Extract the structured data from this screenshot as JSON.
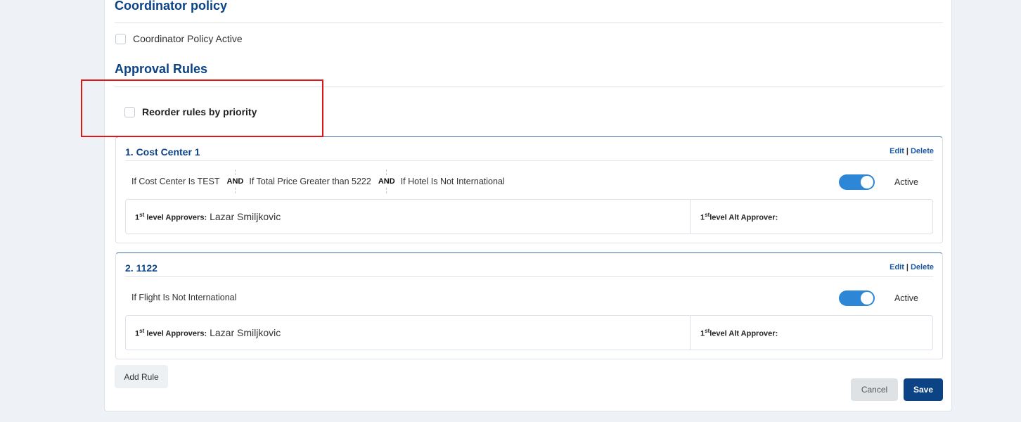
{
  "coordinator": {
    "title": "Coordinator policy",
    "checkbox_label": "Coordinator Policy Active"
  },
  "approval_rules": {
    "title": "Approval Rules",
    "reorder_label": "Reorder rules by priority"
  },
  "rules": [
    {
      "title": "1. Cost Center 1",
      "edit_label": "Edit",
      "delete_label": "Delete",
      "conditions": [
        "If Cost Center Is TEST",
        "If Total Price Greater than 5222",
        "If Hotel Is Not International"
      ],
      "connector": "AND",
      "status_label": "Active",
      "active": true,
      "approver_level_label": "level Approvers:",
      "approver_name": "Lazar Smiljkovic",
      "alt_approver_label": "level Alt Approver:"
    },
    {
      "title": "2. 1122",
      "edit_label": "Edit",
      "delete_label": "Delete",
      "conditions": [
        "If Flight Is Not International"
      ],
      "status_label": "Active",
      "active": true,
      "approver_level_label": "level Approvers:",
      "approver_name": "Lazar Smiljkovic",
      "alt_approver_label": "level Alt Approver:"
    }
  ],
  "ordinal": {
    "num": "1",
    "suffix": "st"
  },
  "buttons": {
    "add_rule": "Add Rule",
    "cancel": "Cancel",
    "save": "Save"
  },
  "colors": {
    "brand": "#0c4385",
    "toggle_on": "#2e86d6",
    "highlight": "#e01515"
  }
}
